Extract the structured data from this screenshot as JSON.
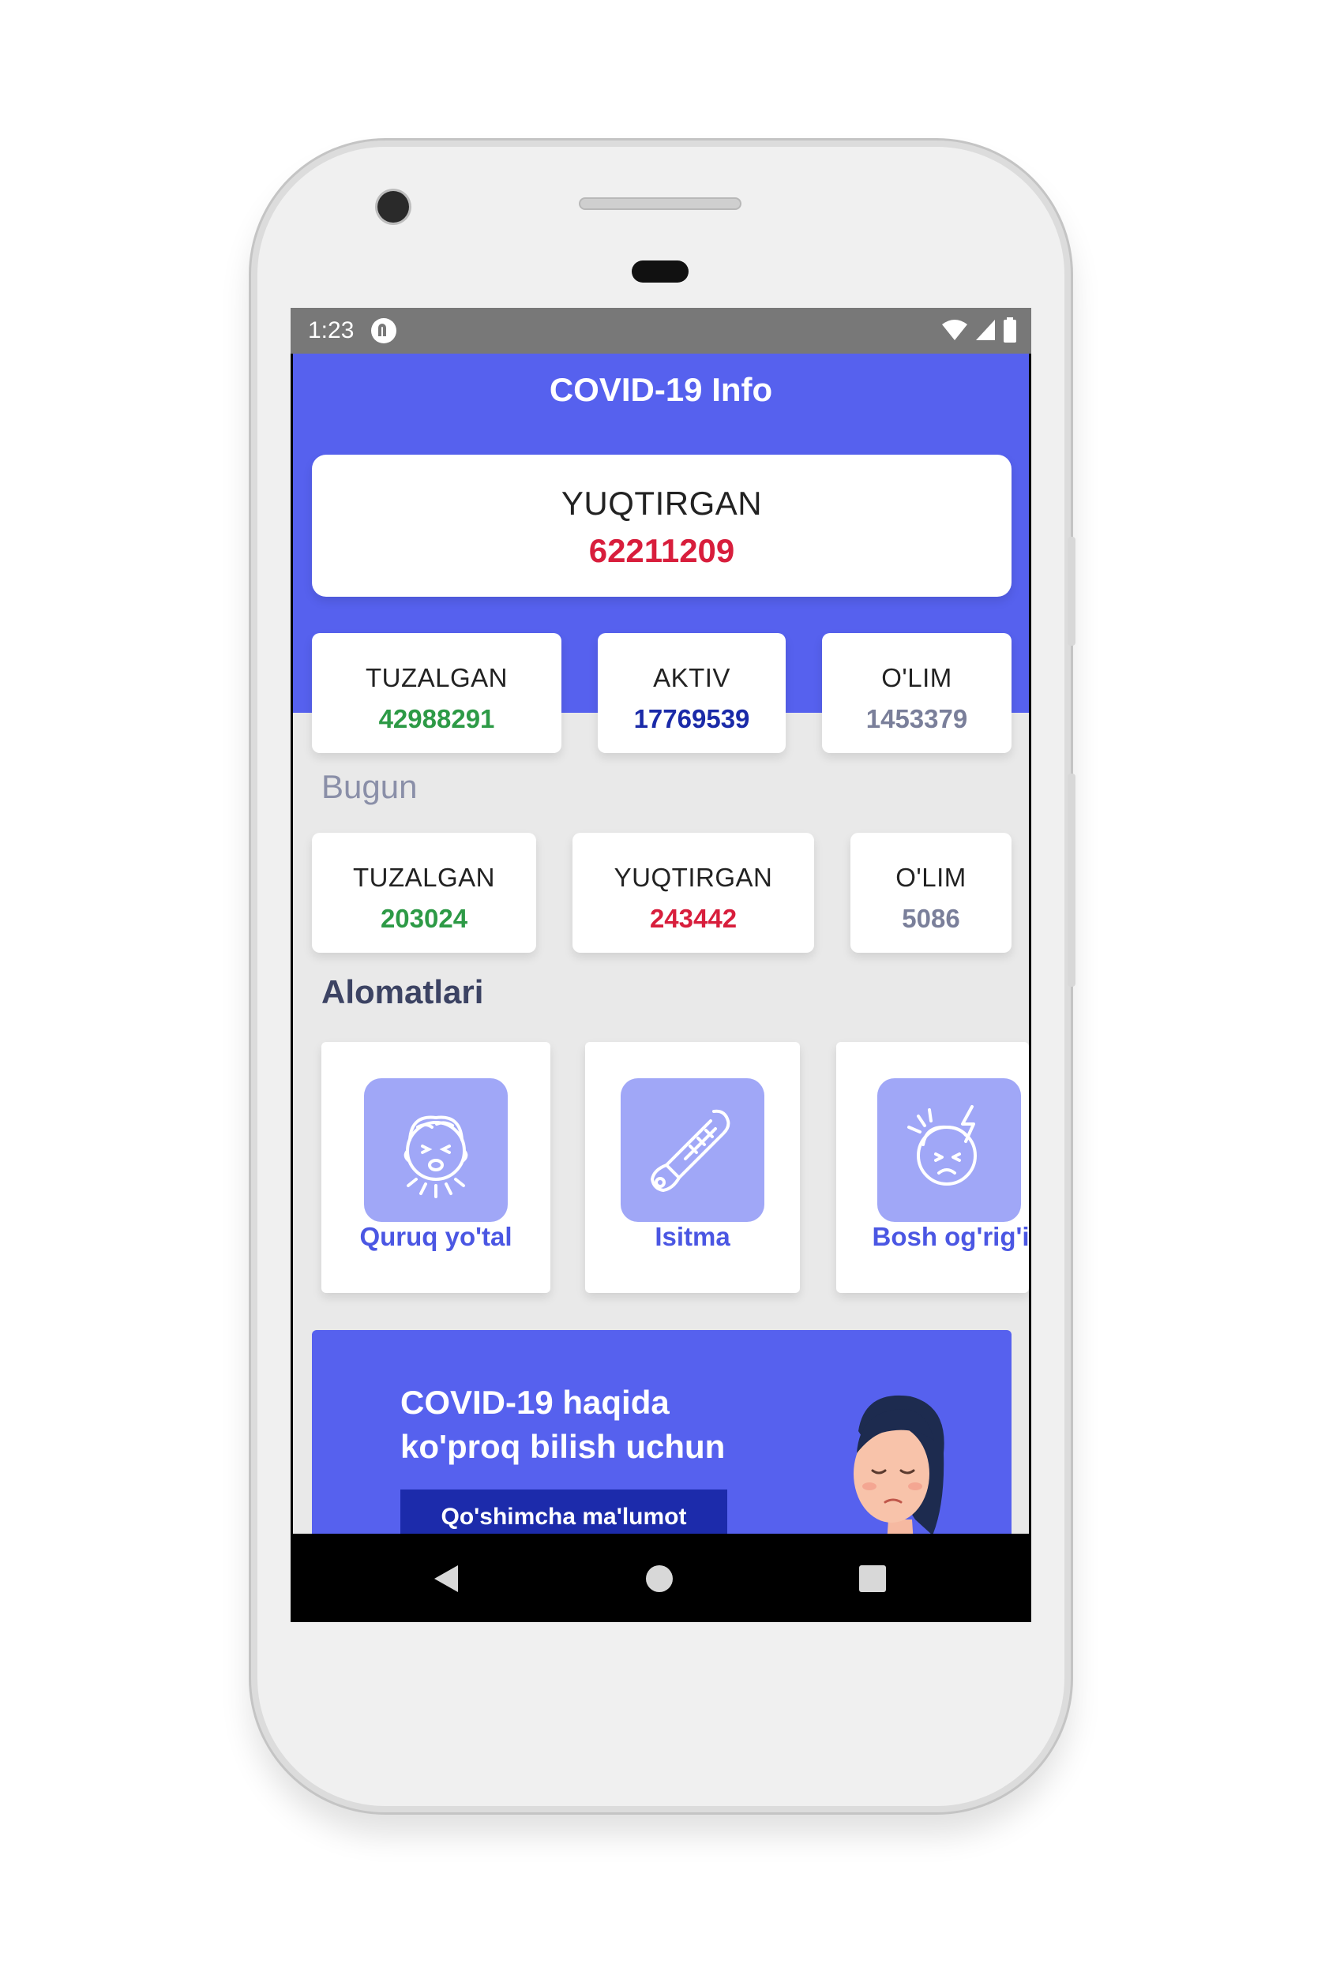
{
  "status_bar": {
    "time": "1:23"
  },
  "app": {
    "title": "COVID-19 Info"
  },
  "total": {
    "label": "YUQTIRGAN",
    "value": "62211209"
  },
  "stats": [
    {
      "label": "TUZALGAN",
      "value": "42988291"
    },
    {
      "label": "AKTIV",
      "value": "17769539"
    },
    {
      "label": "O'LIM",
      "value": "1453379"
    }
  ],
  "today": {
    "heading": "Bugun",
    "cards": [
      {
        "label": "TUZALGAN",
        "value": "203024"
      },
      {
        "label": "YUQTIRGAN",
        "value": "243442"
      },
      {
        "label": "O'LIM",
        "value": "5086"
      }
    ]
  },
  "symptoms": {
    "heading": "Alomatlari",
    "items": [
      {
        "label": "Quruq yo'tal",
        "icon": "coughing-face-icon"
      },
      {
        "label": "Isitma",
        "icon": "thermometer-icon"
      },
      {
        "label": "Bosh og'rig'i",
        "icon": "headache-icon"
      }
    ]
  },
  "banner": {
    "title_line1": "COVID-19 haqida",
    "title_line2": "ko'proq bilish uchun",
    "button_label": "Qo'shimcha ma'lumot"
  },
  "colors": {
    "primary": "#5661ee",
    "recovered": "#2d9a46",
    "infected": "#d81e3c",
    "active": "#1a2aa8",
    "deaths": "#7a7f9a",
    "symptom_tile": "#a0a7f7"
  }
}
